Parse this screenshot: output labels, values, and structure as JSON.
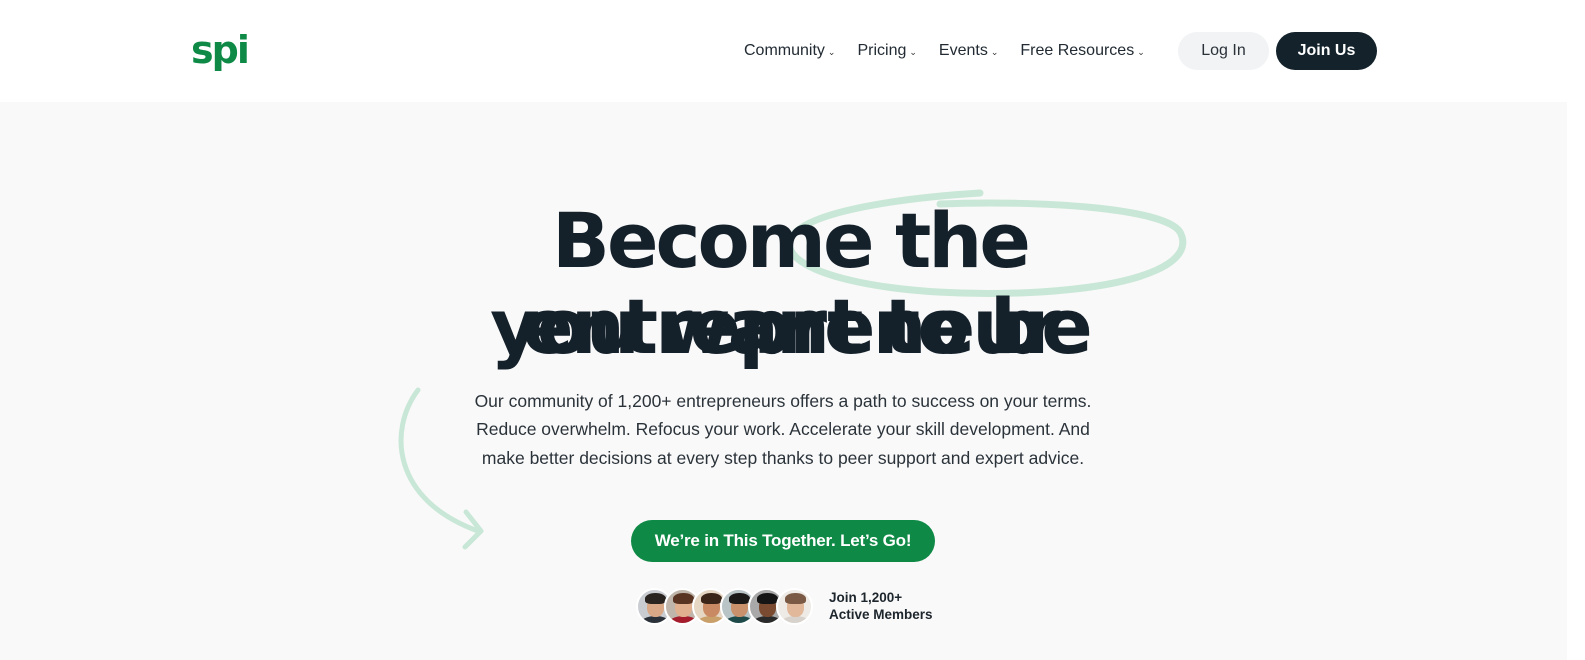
{
  "header": {
    "logo_text": "spi",
    "nav": [
      {
        "label": "Community",
        "icon": "chevron-down-icon"
      },
      {
        "label": "Pricing",
        "icon": "chevron-down-icon"
      },
      {
        "label": "Events",
        "icon": "chevron-down-icon"
      },
      {
        "label": "Free Resources",
        "icon": "chevron-down-icon"
      }
    ],
    "login_label": "Log In",
    "join_label": "Join Us"
  },
  "hero": {
    "headline_line1": "Become the entrepreneur",
    "headline_line2": "you want to be",
    "subtext_line1": "Our community of 1,200+ entrepreneurs offers a path to success on your terms.",
    "subtext_line2": "Reduce overwhelm. Refocus your work. Accelerate your skill development. And",
    "subtext_line3": "make better decisions at every step thanks to peer support and expert advice.",
    "cta_label": "We’re in This Together. Let’s Go!",
    "members_line1": "Join 1,200+",
    "members_line2": "Active Members"
  },
  "colors": {
    "brand_green": "#0e8a46",
    "dark_navy": "#13222b",
    "swoosh_green": "#c9e7d7",
    "page_bg": "#f9f9f9"
  }
}
